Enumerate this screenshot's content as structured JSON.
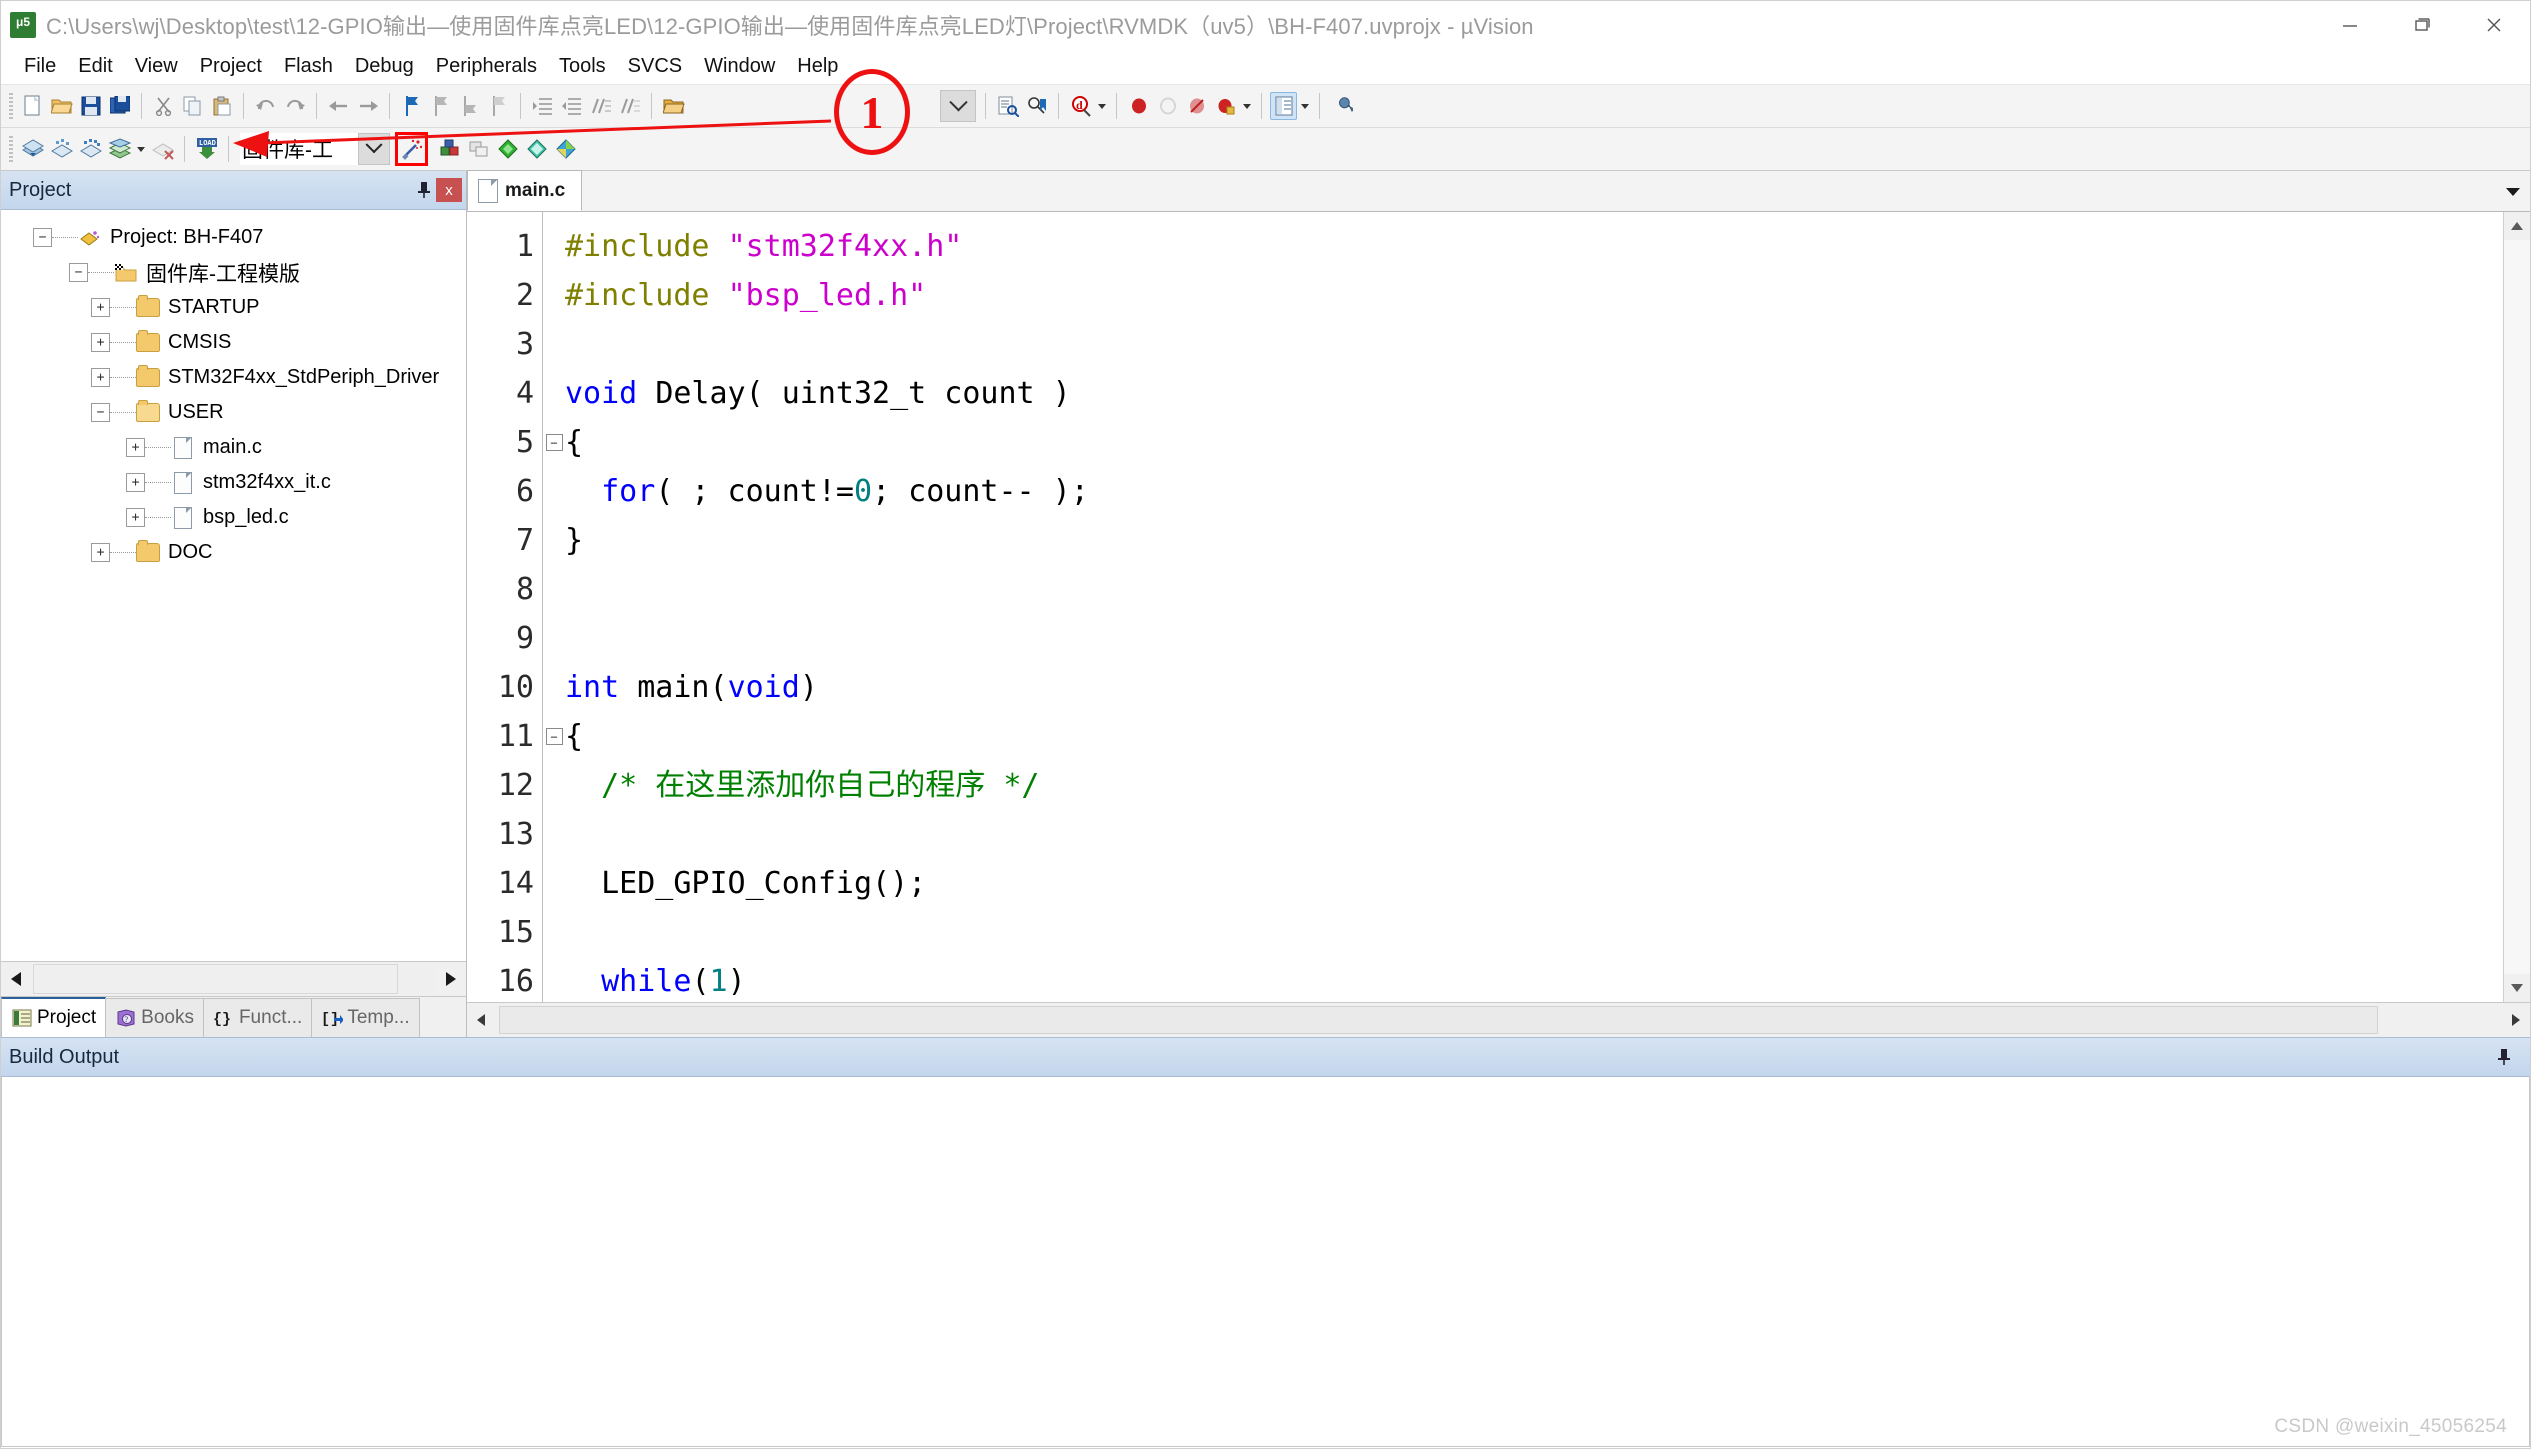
{
  "window": {
    "title": "C:\\Users\\wj\\Desktop\\test\\12-GPIO输出—使用固件库点亮LED\\12-GPIO输出—使用固件库点亮LED灯\\Project\\RVMDK（uv5）\\BH-F407.uvprojx - µVision",
    "app_icon_name": "uvision-icon",
    "minimize_label": "—",
    "maximize_label": "❐",
    "close_label": "✕"
  },
  "menubar": {
    "items": [
      {
        "label": "File"
      },
      {
        "label": "Edit"
      },
      {
        "label": "View"
      },
      {
        "label": "Project"
      },
      {
        "label": "Flash"
      },
      {
        "label": "Debug"
      },
      {
        "label": "Peripherals"
      },
      {
        "label": "Tools"
      },
      {
        "label": "SVCS"
      },
      {
        "label": "Window"
      },
      {
        "label": "Help"
      }
    ]
  },
  "toolbar_main": {
    "buttons": [
      {
        "name": "new-file",
        "icon": "new-file-icon"
      },
      {
        "name": "open-file",
        "icon": "open-folder-icon"
      },
      {
        "name": "save",
        "icon": "save-disk-icon"
      },
      {
        "name": "save-all",
        "icon": "save-all-icon"
      },
      {
        "name": "cut",
        "icon": "scissors-icon"
      },
      {
        "name": "copy",
        "icon": "copy-icon"
      },
      {
        "name": "paste",
        "icon": "paste-icon"
      },
      {
        "name": "undo",
        "icon": "undo-arrow-icon"
      },
      {
        "name": "redo",
        "icon": "redo-arrow-icon"
      },
      {
        "name": "navigate-back",
        "icon": "arrow-left-icon"
      },
      {
        "name": "navigate-forward",
        "icon": "arrow-right-icon"
      },
      {
        "name": "bookmark-toggle",
        "icon": "bookmark-flag-icon"
      },
      {
        "name": "bookmark-prev",
        "icon": "bookmark-prev-icon"
      },
      {
        "name": "bookmark-next",
        "icon": "bookmark-next-icon"
      },
      {
        "name": "bookmark-clear",
        "icon": "bookmark-clear-icon"
      },
      {
        "name": "indent",
        "icon": "indent-icon"
      },
      {
        "name": "outdent",
        "icon": "outdent-icon"
      },
      {
        "name": "comment-lines",
        "icon": "comment-icon"
      },
      {
        "name": "uncomment-lines",
        "icon": "uncomment-icon"
      },
      {
        "name": "open-folder-2",
        "icon": "folder-open-icon"
      }
    ],
    "find_combo_value": "",
    "right_buttons": [
      {
        "name": "find-in-files",
        "icon": "find-in-files-icon"
      },
      {
        "name": "insert-bookmark",
        "icon": "insert-bookmark-icon"
      },
      {
        "name": "find-symbol",
        "icon": "find-symbol-icon"
      },
      {
        "name": "breakpoint-insert",
        "icon": "breakpoint-red-dot-icon"
      },
      {
        "name": "breakpoint-disable",
        "icon": "breakpoint-disable-icon"
      },
      {
        "name": "breakpoint-kill-all",
        "icon": "breakpoint-kill-icon"
      },
      {
        "name": "breakpoint-disable-all",
        "icon": "breakpoint-disable-all-icon"
      },
      {
        "name": "window-layout",
        "icon": "window-layout-icon"
      },
      {
        "name": "configure",
        "icon": "wrench-icon"
      }
    ]
  },
  "toolbar_build": {
    "buttons": [
      {
        "name": "translate-file",
        "icon": "translate-icon"
      },
      {
        "name": "build-target",
        "icon": "build-icon"
      },
      {
        "name": "rebuild-all",
        "icon": "rebuild-icon"
      },
      {
        "name": "batch-build",
        "icon": "batch-build-icon"
      },
      {
        "name": "stop-build",
        "icon": "stop-build-icon"
      },
      {
        "name": "download",
        "icon": "load-download-icon"
      }
    ],
    "target_selector_value": "固件库-工程模版",
    "target_selector_display": "固件库-工",
    "after_buttons": [
      {
        "name": "target-options",
        "icon": "magic-wand-options-icon",
        "highlighted": true
      },
      {
        "name": "manage-project-items",
        "icon": "project-components-icon"
      },
      {
        "name": "manage-multi-project",
        "icon": "multi-project-icon"
      },
      {
        "name": "svcs-green",
        "icon": "green-diamond-icon"
      },
      {
        "name": "svcs-teal",
        "icon": "teal-diamond-icon"
      },
      {
        "name": "pack-installer",
        "icon": "pack-installer-icon"
      }
    ]
  },
  "annotation": {
    "marker_label": "1",
    "color": "#ee1111"
  },
  "project_pane": {
    "title": "Project",
    "pin_icon": "pin-icon",
    "close_icon": "close-icon",
    "tree": [
      {
        "label": "Project: BH-F407",
        "level": 0,
        "expander": "−",
        "icon": "project-icon"
      },
      {
        "label": "固件库-工程模版",
        "level": 1,
        "expander": "−",
        "icon": "target-folder-icon",
        "cn": true
      },
      {
        "label": "STARTUP",
        "level": 2,
        "expander": "+",
        "icon": "folder-icon"
      },
      {
        "label": "CMSIS",
        "level": 2,
        "expander": "+",
        "icon": "folder-icon"
      },
      {
        "label": "STM32F4xx_StdPeriph_Driver",
        "level": 2,
        "expander": "+",
        "icon": "folder-icon"
      },
      {
        "label": "USER",
        "level": 2,
        "expander": "−",
        "icon": "folder-open-icon"
      },
      {
        "label": "main.c",
        "level": 3,
        "expander": "+",
        "icon": "c-file-icon"
      },
      {
        "label": "stm32f4xx_it.c",
        "level": 3,
        "expander": "+",
        "icon": "c-file-icon"
      },
      {
        "label": "bsp_led.c",
        "level": 3,
        "expander": "+",
        "icon": "c-file-icon"
      },
      {
        "label": "DOC",
        "level": 2,
        "expander": "+",
        "icon": "folder-icon"
      }
    ],
    "bottom_tabs": [
      {
        "label": "Project",
        "icon": "project-tab-icon",
        "selected": true
      },
      {
        "label": "Books",
        "icon": "books-icon",
        "selected": false
      },
      {
        "label": "Funct...",
        "icon": "functions-icon",
        "selected": false
      },
      {
        "label": "Temp...",
        "icon": "templates-icon",
        "selected": false
      }
    ]
  },
  "editor": {
    "tabs": [
      {
        "label": "main.c",
        "icon": "c-file-icon",
        "active": true
      }
    ],
    "tabstrip_caret_icon": "chevron-down-icon",
    "lines": [
      {
        "no": "1",
        "tokens": [
          {
            "t": "#include ",
            "c": "pp"
          },
          {
            "t": "\"stm32f4xx.h\"",
            "c": "str"
          }
        ],
        "fold": ""
      },
      {
        "no": "2",
        "tokens": [
          {
            "t": "#include ",
            "c": "pp"
          },
          {
            "t": "\"bsp_led.h\"",
            "c": "str"
          }
        ],
        "fold": ""
      },
      {
        "no": "3",
        "tokens": [],
        "fold": ""
      },
      {
        "no": "4",
        "tokens": [
          {
            "t": "void ",
            "c": "k"
          },
          {
            "t": "Delay( uint32_t count )",
            "c": ""
          }
        ],
        "fold": ""
      },
      {
        "no": "5",
        "tokens": [
          {
            "t": "{",
            "c": ""
          }
        ],
        "fold": "−"
      },
      {
        "no": "6",
        "tokens": [
          {
            "t": "  ",
            "c": ""
          },
          {
            "t": "for",
            "c": "k"
          },
          {
            "t": "( ; count!=",
            "c": ""
          },
          {
            "t": "0",
            "c": "num"
          },
          {
            "t": "; count-- );",
            "c": ""
          }
        ],
        "fold": ""
      },
      {
        "no": "7",
        "tokens": [
          {
            "t": "}",
            "c": ""
          }
        ],
        "fold": ""
      },
      {
        "no": "8",
        "tokens": [],
        "fold": ""
      },
      {
        "no": "9",
        "tokens": [],
        "fold": ""
      },
      {
        "no": "10",
        "tokens": [
          {
            "t": "int ",
            "c": "k"
          },
          {
            "t": "main(",
            "c": ""
          },
          {
            "t": "void",
            "c": "k"
          },
          {
            "t": ")",
            "c": ""
          }
        ],
        "fold": ""
      },
      {
        "no": "11",
        "tokens": [
          {
            "t": "{",
            "c": ""
          }
        ],
        "fold": "−"
      },
      {
        "no": "12",
        "tokens": [
          {
            "t": "  /* 在这里添加你自己的程序 */",
            "c": "cm"
          }
        ],
        "fold": ""
      },
      {
        "no": "13",
        "tokens": [],
        "fold": ""
      },
      {
        "no": "14",
        "tokens": [
          {
            "t": "  LED_GPIO_Config();",
            "c": ""
          }
        ],
        "fold": ""
      },
      {
        "no": "15",
        "tokens": [],
        "fold": ""
      },
      {
        "no": "16",
        "tokens": [
          {
            "t": "  ",
            "c": ""
          },
          {
            "t": "while",
            "c": "k"
          },
          {
            "t": "(",
            "c": ""
          },
          {
            "t": "1",
            "c": "num"
          },
          {
            "t": ")",
            "c": ""
          }
        ],
        "fold": ""
      }
    ]
  },
  "build_output": {
    "title": "Build Output",
    "pin_icon": "pin-icon",
    "content": ""
  },
  "watermark": {
    "text": "CSDN @weixin_45056254"
  },
  "colors": {
    "accent": "#2a6099",
    "annotation_red": "#ee1111",
    "keyword_blue": "#0000ff",
    "string_magenta": "#cc00cc",
    "comment_green": "#008000",
    "preproc_olive": "#808000"
  }
}
